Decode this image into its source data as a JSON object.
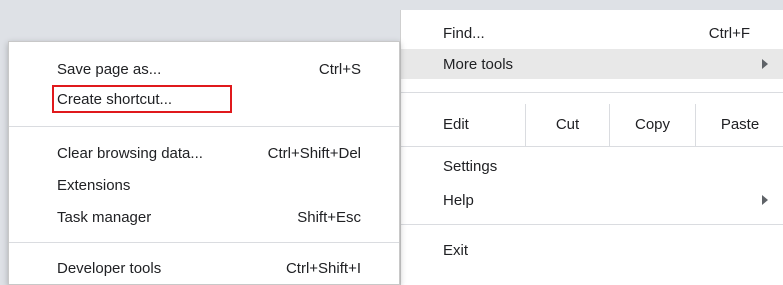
{
  "main_menu": {
    "find": {
      "label": "Find...",
      "shortcut": "Ctrl+F"
    },
    "more_tools": {
      "label": "More tools"
    },
    "edit": {
      "label": "Edit",
      "cut": "Cut",
      "copy": "Copy",
      "paste": "Paste"
    },
    "settings": {
      "label": "Settings"
    },
    "help": {
      "label": "Help"
    },
    "exit": {
      "label": "Exit"
    }
  },
  "more_tools_submenu": {
    "items": [
      {
        "label": "Save page as...",
        "shortcut": "Ctrl+S"
      },
      {
        "label": "Create shortcut...",
        "shortcut": ""
      },
      {
        "label": "Clear browsing data...",
        "shortcut": "Ctrl+Shift+Del"
      },
      {
        "label": "Extensions",
        "shortcut": ""
      },
      {
        "label": "Task manager",
        "shortcut": "Shift+Esc"
      },
      {
        "label": "Developer tools",
        "shortcut": "Ctrl+Shift+I"
      }
    ]
  },
  "colors": {
    "highlight_border": "#e0191c",
    "hover_bg": "#e8e8e8"
  }
}
